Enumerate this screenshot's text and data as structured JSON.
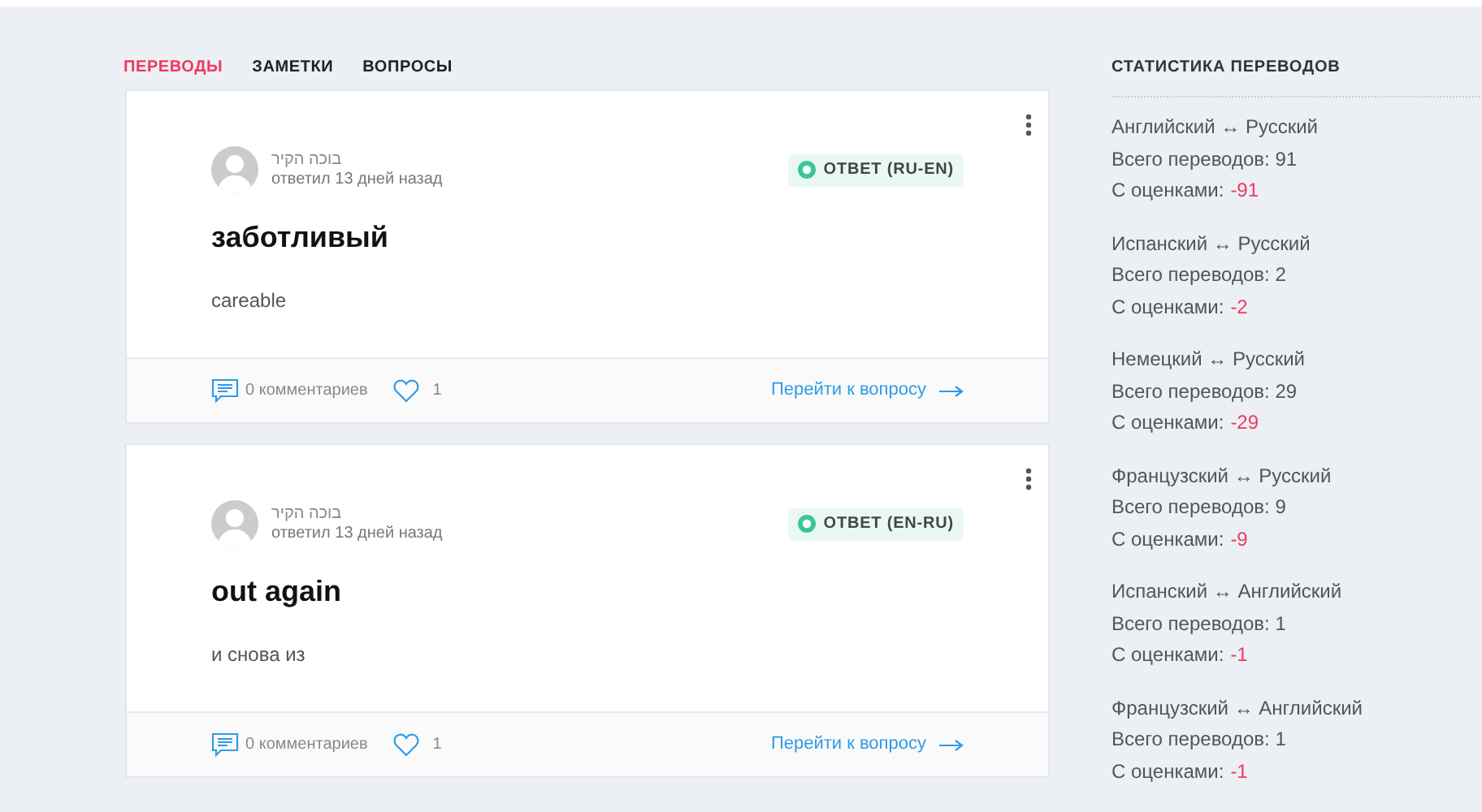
{
  "tabs": [
    {
      "label": "ПЕРЕВОДЫ",
      "selected": true
    },
    {
      "label": "ЗАМЕТКИ",
      "selected": false
    },
    {
      "label": "ВОПРОСЫ",
      "selected": false
    }
  ],
  "posts": [
    {
      "author": "בוכה הקיר",
      "time": "ответил 13 дней назад",
      "badge": "ОТВЕТ (RU-EN)",
      "title": "заботливый",
      "text": "careable",
      "comments": "0 комментариев",
      "likes": "1",
      "link": "Перейти к вопросу"
    },
    {
      "author": "בוכה הקיר",
      "time": "ответил 13 дней назад",
      "badge": "ОТВЕТ (EN-RU)",
      "title": "out again",
      "text": "и снова из",
      "comments": "0 комментариев",
      "likes": "1",
      "link": "Перейти к вопросу"
    }
  ],
  "stats": {
    "title": "СТАТИСТИКА ПЕРЕВОДОВ",
    "groups": [
      {
        "pair": "Английский ↔ Русский",
        "total": "Всего переводов: 91",
        "rated_label": "С оценками:",
        "rated_value": "-91"
      },
      {
        "pair": "Испанский ↔ Русский",
        "total": "Всего переводов: 2",
        "rated_label": "С оценками:",
        "rated_value": "-2"
      },
      {
        "pair": "Немецкий ↔ Русский",
        "total": "Всего переводов: 29",
        "rated_label": "С оценками:",
        "rated_value": "-29"
      },
      {
        "pair": "Французский ↔ Русский",
        "total": "Всего переводов: 9",
        "rated_label": "С оценками:",
        "rated_value": "-9"
      },
      {
        "pair": "Испанский ↔ Английский",
        "total": "Всего переводов: 1",
        "rated_label": "С оценками:",
        "rated_value": "-1"
      },
      {
        "pair": "Французский ↔ Английский",
        "total": "Всего переводов: 1",
        "rated_label": "С оценками:",
        "rated_value": "-1"
      }
    ]
  }
}
